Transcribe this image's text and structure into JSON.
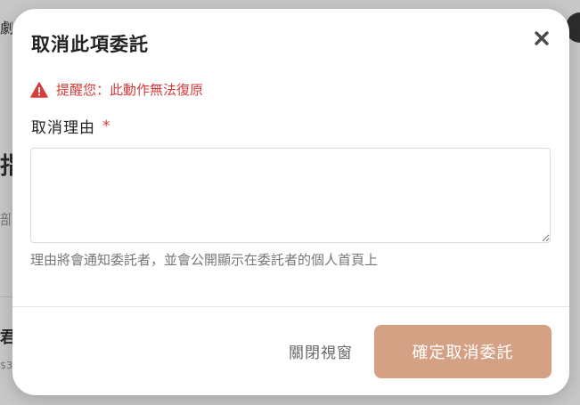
{
  "background_page": {
    "fragments": [
      "劇",
      "指",
      "部",
      "君",
      "$3"
    ]
  },
  "modal": {
    "title": "取消此項委託",
    "close_icon": "close-icon",
    "warning": {
      "icon": "warning-triangle-icon",
      "text": "提醒您：此動作無法復原"
    },
    "reason_field": {
      "label": "取消理由",
      "required_mark": "*",
      "value": "",
      "placeholder": ""
    },
    "help_text": "理由將會通知委託者，並會公開顯示在委託者的個人首頁上",
    "buttons": {
      "close_label": "關閉視窗",
      "confirm_label": "確定取消委託"
    }
  },
  "colors": {
    "accent": "#d4a185",
    "warning": "#d93a3a"
  }
}
